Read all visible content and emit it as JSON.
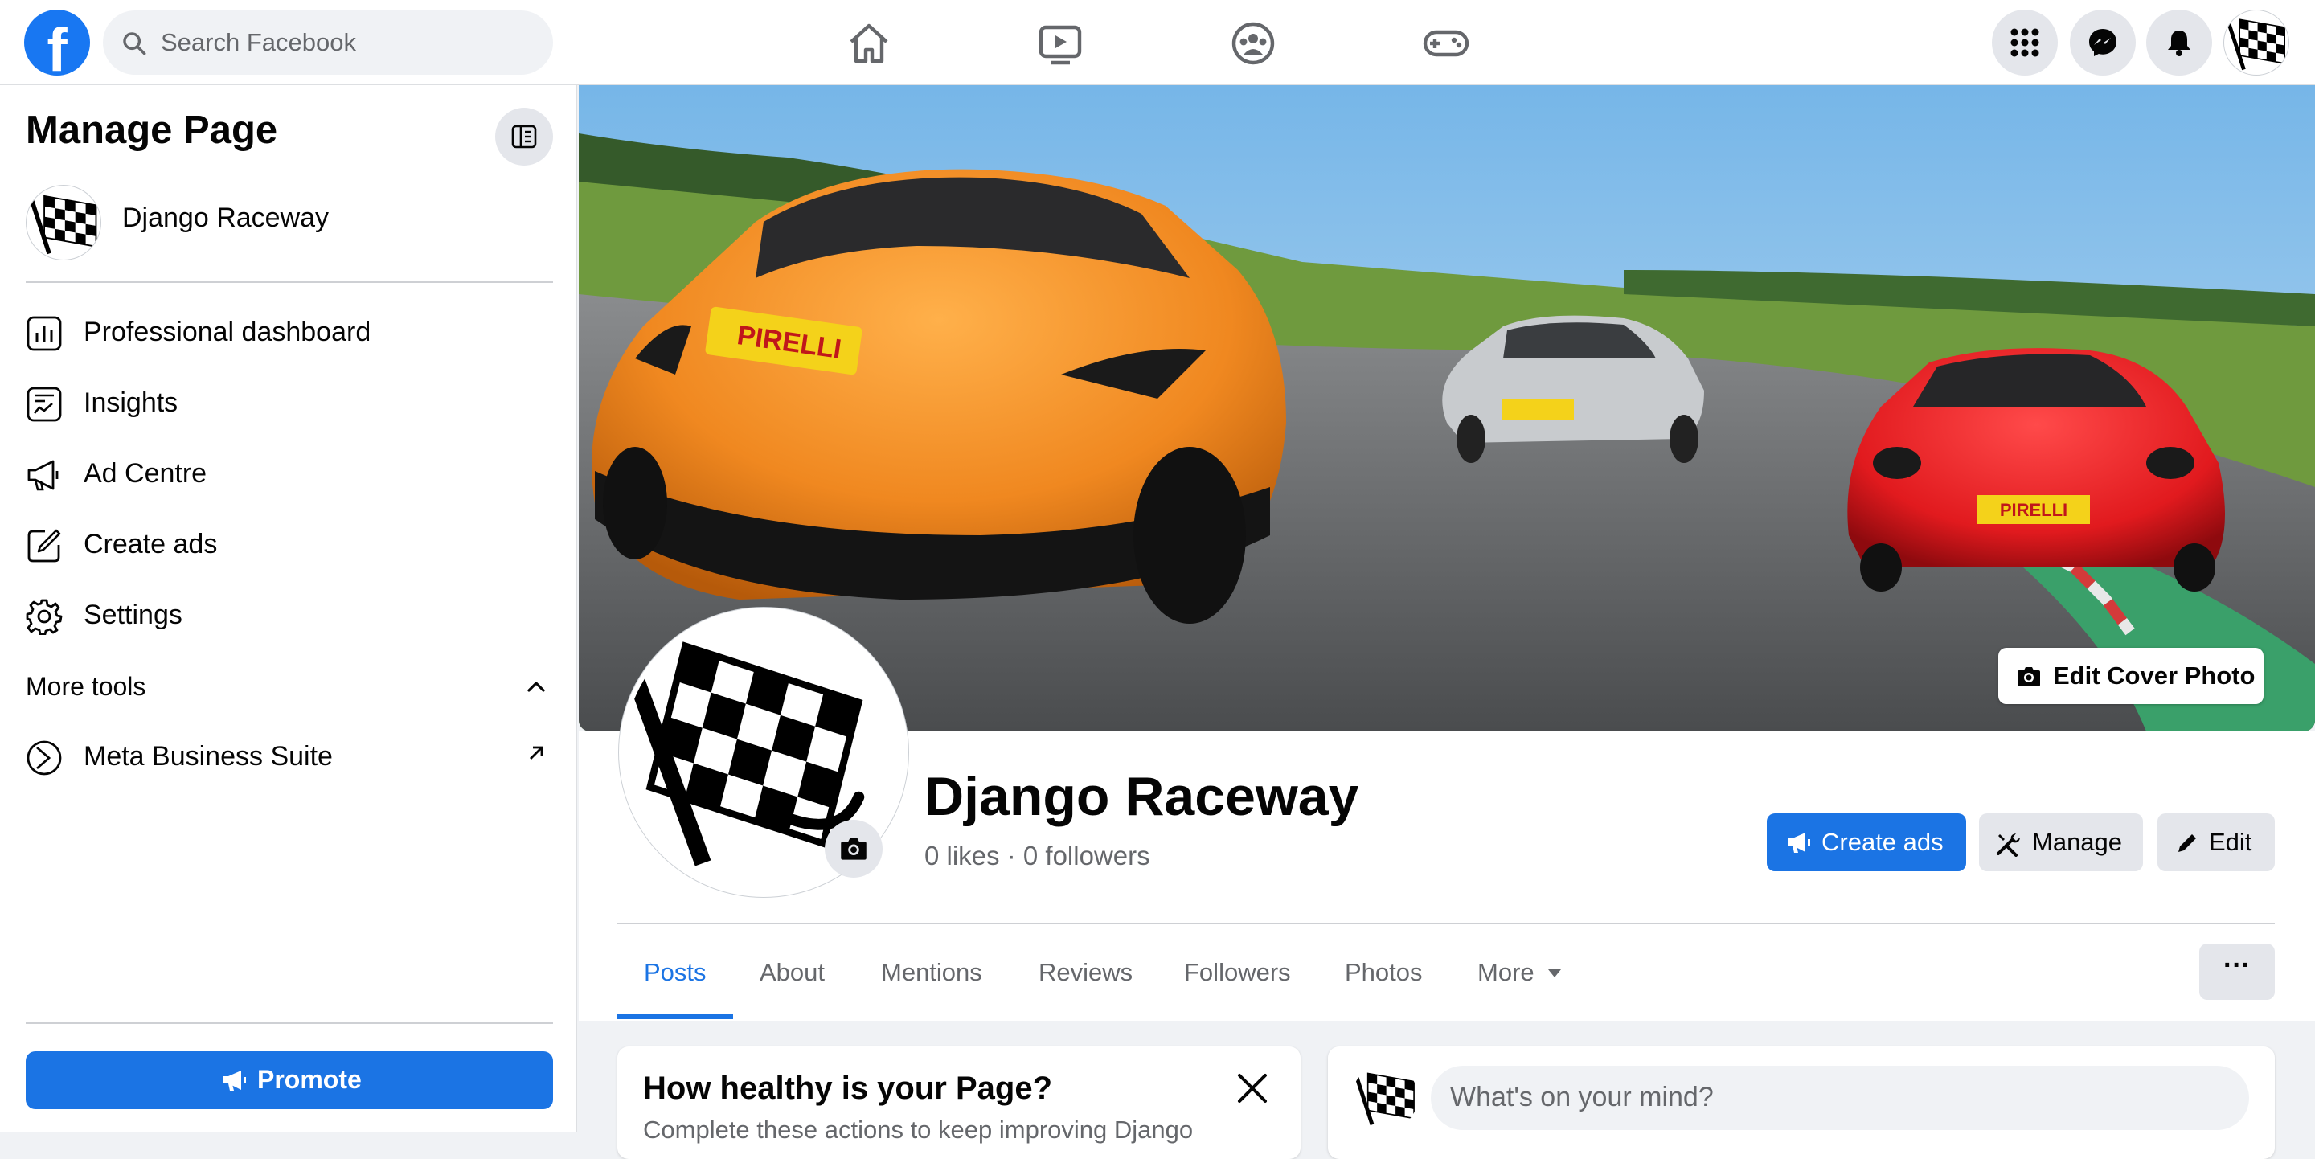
{
  "header": {
    "search_placeholder": "Search Facebook"
  },
  "sidebar": {
    "title": "Manage Page",
    "page_name": "Django Raceway",
    "items": [
      {
        "label": "Professional dashboard",
        "icon": "dashboard-icon"
      },
      {
        "label": "Insights",
        "icon": "insights-icon"
      },
      {
        "label": "Ad Centre",
        "icon": "megaphone-icon"
      },
      {
        "label": "Create ads",
        "icon": "edit-square-icon"
      },
      {
        "label": "Settings",
        "icon": "gear-icon"
      }
    ],
    "more_tools": "More tools",
    "business_suite": "Meta Business Suite",
    "promote": "Promote"
  },
  "profile": {
    "name": "Django Raceway",
    "likes": "0 likes",
    "followers": "0 followers",
    "edit_cover": "Edit Cover Photo",
    "create_ads": "Create ads",
    "manage": "Manage",
    "edit": "Edit"
  },
  "tabs": [
    "Posts",
    "About",
    "Mentions",
    "Reviews",
    "Followers",
    "Photos",
    "More"
  ],
  "active_tab": "Posts",
  "health_card": {
    "title": "How healthy is your Page?",
    "subtitle": "Complete these actions to keep improving Django"
  },
  "composer": {
    "placeholder": "What's on your mind?"
  },
  "colors": {
    "accent": "#1b74e4",
    "brand": "#1877f2",
    "background": "#f0f2f5"
  }
}
